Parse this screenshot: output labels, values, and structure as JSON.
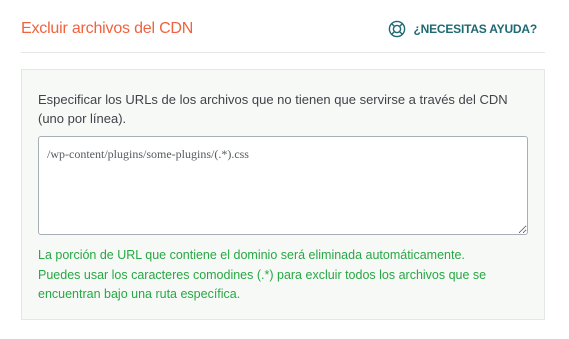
{
  "header": {
    "title": "Excluir archivos del CDN",
    "help_label": "¿NECESITAS AYUDA?",
    "accent_color": "#f1623f",
    "help_color": "#1f6a72",
    "help_icon": "lifebuoy-icon"
  },
  "panel": {
    "description": "Especificar los URLs de los archivos que no tienen que servirse a través del CDN (uno por línea).",
    "textarea": {
      "value": "",
      "placeholder": "/wp-content/plugins/some-plugins/(.*).css"
    },
    "help_text_line1": "La porción de URL que contiene el dominio será eliminada automáticamente.",
    "help_text_line2": "Puedes usar los caracteres comodines (.*) para excluir todos los archivos que se encuentran bajo una ruta específica.",
    "help_text_color": "#27a844"
  }
}
